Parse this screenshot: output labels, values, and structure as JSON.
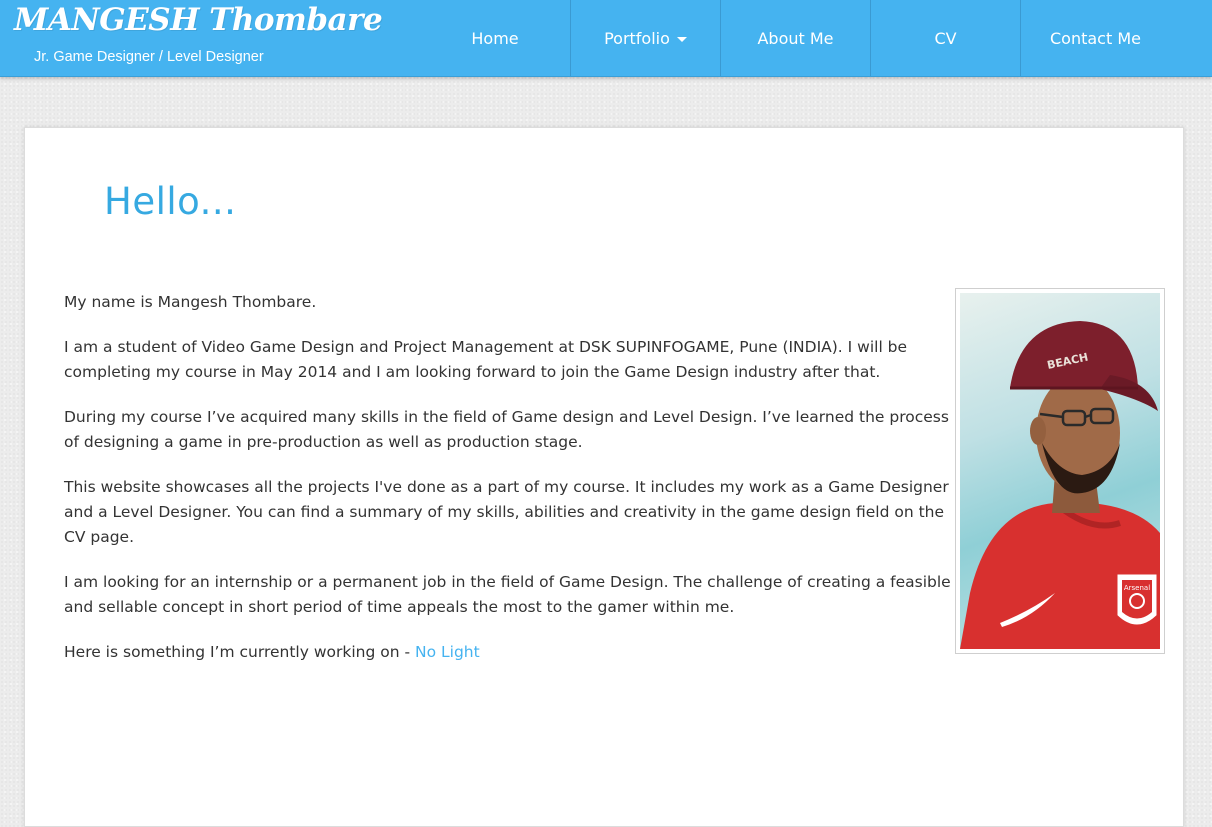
{
  "brand": {
    "title": "MANGESH Thombare",
    "subtitle": "Jr. Game Designer / Level Designer"
  },
  "nav": {
    "items": [
      {
        "label": "Home"
      },
      {
        "label": "Portfolio",
        "has_dropdown": true
      },
      {
        "label": "About Me"
      },
      {
        "label": "CV"
      },
      {
        "label": "Contact Me"
      }
    ]
  },
  "main": {
    "heading": "Hello...",
    "paragraphs": [
      "My name is Mangesh Thombare.",
      "I am a student of Video Game Design and Project Management at DSK SUPINFOGAME, Pune (INDIA). I will be completing my course in May 2014 and I am looking forward to join the Game Design industry after that.",
      "During my course I’ve acquired many skills in the field of Game design and Level Design. I’ve learned the process of designing a game in pre-production as well as production stage.",
      "This website showcases all the projects I've done as a part of my course. It includes my work as a Game Designer and a Level Designer. You can find a summary of my skills, abilities and creativity in the game design field on the CV page.",
      "I am looking for an internship or a permanent job in the field of Game Design. The challenge of creating a feasible and sellable concept in short period of time appeals the most to the gamer within me."
    ],
    "working_on_prefix": "Here is something I’m currently working on - ",
    "working_on_link": "No Light"
  },
  "photo": {
    "cap_text": "BEACH",
    "shirt_text": "Arsenal"
  },
  "colors": {
    "nav_bg": "#45b3f0",
    "accent": "#36a9e1",
    "text": "#333333",
    "page_bg": "#ececec"
  }
}
